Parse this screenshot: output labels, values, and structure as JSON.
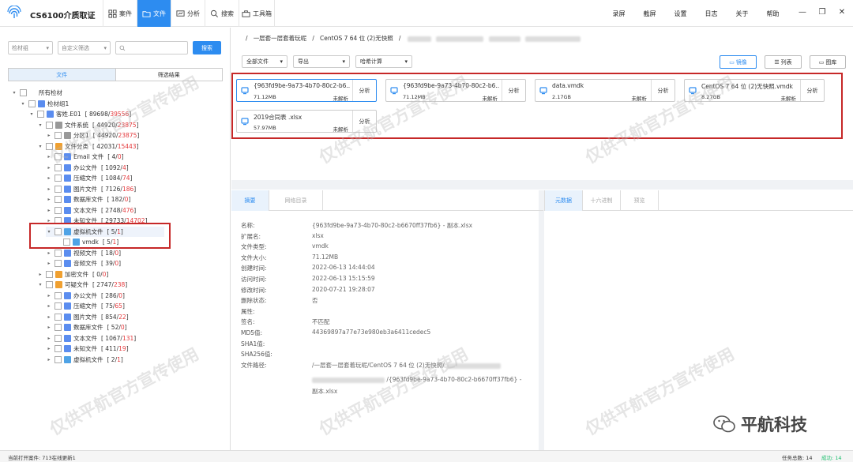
{
  "app": {
    "title": "CS6100介质取证"
  },
  "nav": [
    {
      "label": "案件",
      "icon": "case-icon"
    },
    {
      "label": "文件",
      "icon": "file-icon",
      "active": true
    },
    {
      "label": "分析",
      "icon": "analysis-icon"
    },
    {
      "label": "搜索",
      "icon": "search-icon"
    },
    {
      "label": "工具箱",
      "icon": "toolbox-icon"
    }
  ],
  "menu": [
    "录屏",
    "截屏",
    "设置",
    "日志",
    "关于",
    "帮助"
  ],
  "window": {
    "minimize": "—",
    "restore": "❐",
    "close": "✕"
  },
  "left": {
    "filter1": "检材组",
    "filter2": "自定义筛选",
    "search_placeholder": "",
    "search_button": "搜索",
    "tab_files": "文件",
    "tab_results": "筛选结果"
  },
  "tree": [
    {
      "label": "所有检材",
      "count": "",
      "red": "",
      "level": 0
    },
    {
      "label": "检材组1",
      "count": "",
      "red": "",
      "level": 1
    },
    {
      "label": "客姓.E01",
      "count": "[ 89698/",
      "red": "39556",
      "tail": " ]",
      "level": 2
    },
    {
      "label": "文件系统",
      "count": "[ 44920/",
      "red": "23875",
      "tail": " ]",
      "level": 3
    },
    {
      "label": "分区1",
      "count": "[ 44920/",
      "red": "23875",
      "tail": " ]",
      "level": 4
    },
    {
      "label": "文件分类",
      "count": "[ 42031/",
      "red": "15443",
      "tail": " ]",
      "level": 3
    },
    {
      "label": "Email 文件",
      "count": "[ 4/",
      "red": "0",
      "tail": " ]",
      "level": 4
    },
    {
      "label": "办公文件",
      "count": "[ 1092/",
      "red": "4",
      "tail": " ]",
      "level": 4
    },
    {
      "label": "压缩文件",
      "count": "[ 1084/",
      "red": "74",
      "tail": " ]",
      "level": 4
    },
    {
      "label": "图片文件",
      "count": "[ 7126/",
      "red": "186",
      "tail": " ]",
      "level": 4
    },
    {
      "label": "数据库文件",
      "count": "[ 182/",
      "red": "0",
      "tail": " ]",
      "level": 4
    },
    {
      "label": "文本文件",
      "count": "[ 2748/",
      "red": "476",
      "tail": " ]",
      "level": 4
    },
    {
      "label": "未知文件",
      "count": "[ 29733/",
      "red": "14702",
      "tail": " ]",
      "level": 4
    },
    {
      "label": "虚拟机文件",
      "count": "[ 5/",
      "red": "1",
      "tail": " ]",
      "level": 4
    },
    {
      "label": "vmdk",
      "count": "[ 5/",
      "red": "1",
      "tail": " ]",
      "level": 5
    },
    {
      "label": "视频文件",
      "count": "[ 18/",
      "red": "0",
      "tail": " ]",
      "level": 4
    },
    {
      "label": "音频文件",
      "count": "[ 39/",
      "red": "0",
      "tail": " ]",
      "level": 4
    },
    {
      "label": "加密文件",
      "count": "[ 0/",
      "red": "0",
      "tail": " ]",
      "level": 3
    },
    {
      "label": "可疑文件",
      "count": "[ 2747/",
      "red": "238",
      "tail": " ]",
      "level": 3
    },
    {
      "label": "办公文件",
      "count": "[ 286/",
      "red": "0",
      "tail": " ]",
      "level": 4
    },
    {
      "label": "压缩文件",
      "count": "[ 75/",
      "red": "65",
      "tail": " ]",
      "level": 4
    },
    {
      "label": "图片文件",
      "count": "[ 854/",
      "red": "22",
      "tail": " ]",
      "level": 4
    },
    {
      "label": "数据库文件",
      "count": "[ 52/",
      "red": "0",
      "tail": " ]",
      "level": 4
    },
    {
      "label": "文本文件",
      "count": "[ 1067/",
      "red": "131",
      "tail": " ]",
      "level": 4
    },
    {
      "label": "未知文件",
      "count": "[ 411/",
      "red": "19",
      "tail": " ]",
      "level": 4
    },
    {
      "label": "虚拟机文件",
      "count": "[ 2/",
      "red": "1",
      "tail": " ]",
      "level": 4
    }
  ],
  "breadcrumb": {
    "sep": "/",
    "p1": "一层套一层套着玩呢",
    "p2": "CentOS 7 64 位 (2)无快照"
  },
  "toolbar": {
    "all_files": "全部文件",
    "export": "导出",
    "hash": "哈希计算",
    "view_mirror": "镜像",
    "view_list": "列表",
    "view_gallery": "图库"
  },
  "cards": [
    {
      "name": "{963fd9be-9a73-4b70-80c2-b6...",
      "size": "71.12MB",
      "status": "未解析",
      "btn": "分析"
    },
    {
      "name": "{963fd9be-9a73-4b70-80c2-b6...",
      "size": "71.12MB",
      "status": "未解析",
      "btn": "分析"
    },
    {
      "name": "data.vmdk",
      "size": "2.17GB",
      "status": "未解析",
      "btn": "分析"
    },
    {
      "name": "CentOS 7 64 位 (2)无快照.vmdk",
      "size": "8.27GB",
      "status": "未解析",
      "btn": "分析"
    },
    {
      "name": "2019合同表 .xlsx",
      "size": "57.97MB",
      "status": "未解析",
      "btn": "分析"
    }
  ],
  "detail_tabs": [
    "摘要",
    "网络目录"
  ],
  "meta_tabs": [
    "元数据",
    "十六进制",
    "预览"
  ],
  "props": [
    {
      "k": "名称:",
      "v": "{963fd9be-9a73-4b70-80c2-b6670ff37fb6} - 副本.xlsx"
    },
    {
      "k": "扩展名:",
      "v": "xlsx"
    },
    {
      "k": "文件类型:",
      "v": "vmdk"
    },
    {
      "k": "文件大小:",
      "v": "71.12MB"
    },
    {
      "k": "创建时间:",
      "v": "2022-06-13 14:44:04"
    },
    {
      "k": "访问时间:",
      "v": "2022-06-13 15:15:59"
    },
    {
      "k": "修改时间:",
      "v": "2020-07-21 19:28:07"
    },
    {
      "k": "删除状态:",
      "v": "否"
    },
    {
      "k": "属性:",
      "v": ""
    },
    {
      "k": "签名:",
      "v": "不匹配"
    },
    {
      "k": "MD5值:",
      "v": "44369897a77e73e980eb3a6411cedec5"
    },
    {
      "k": "SHA1值:",
      "v": ""
    },
    {
      "k": "SHA256值:",
      "v": ""
    },
    {
      "k": "文件路径:",
      "v": "/一层套一层套着玩呢/CentOS 7 64 位 (2)无快照/"
    }
  ],
  "path_line2": "/{963fd9be-9a73-4b70-80c2-b6670ff37fb6} -",
  "path_line3": "副本.xlsx",
  "status": {
    "left": "当前打开案件: 713在线更新1",
    "tasks": "任务总数: 14",
    "success": "成功: 14"
  },
  "watermark": "仅供平航官方宣传使用",
  "brand": "平航科技",
  "colors": {
    "accent": "#2d8cf0",
    "highlight": "#c62828"
  }
}
